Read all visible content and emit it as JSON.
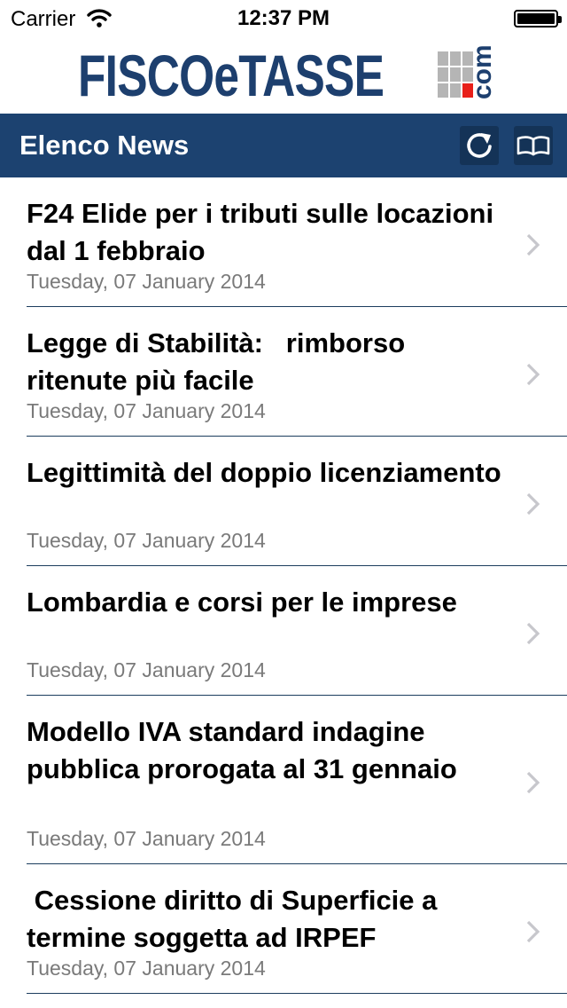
{
  "status_bar": {
    "carrier": "Carrier",
    "time": "12:37 PM",
    "battery_level": 1.0
  },
  "logo": {
    "name": "FISCOeTASSE",
    "suffix": "com",
    "brand_color": "#1d3f6e",
    "accent_color": "#e8201a"
  },
  "navbar": {
    "title": "Elenco News",
    "refresh_icon": "refresh-icon",
    "book_icon": "book-icon",
    "background": "#1c4270"
  },
  "news": [
    {
      "title": "F24 Elide per i tributi sulle locazioni dal 1 febbraio",
      "date": "Tuesday, 07 January 2014"
    },
    {
      "title": "Legge di Stabilità:   rimborso ritenute più facile",
      "date": "Tuesday, 07 January 2014"
    },
    {
      "title": "Legittimità del doppio licenziamento",
      "date": "Tuesday, 07 January 2014"
    },
    {
      "title": "Lombardia e corsi per le imprese",
      "date": "Tuesday, 07 January 2014"
    },
    {
      "title": "Modello IVA standard indagine pubblica prorogata al 31 gennaio",
      "date": "Tuesday, 07 January 2014"
    },
    {
      "title": " Cessione diritto di Superficie a termine soggetta ad IRPEF",
      "date": "Tuesday, 07 January 2014"
    }
  ]
}
